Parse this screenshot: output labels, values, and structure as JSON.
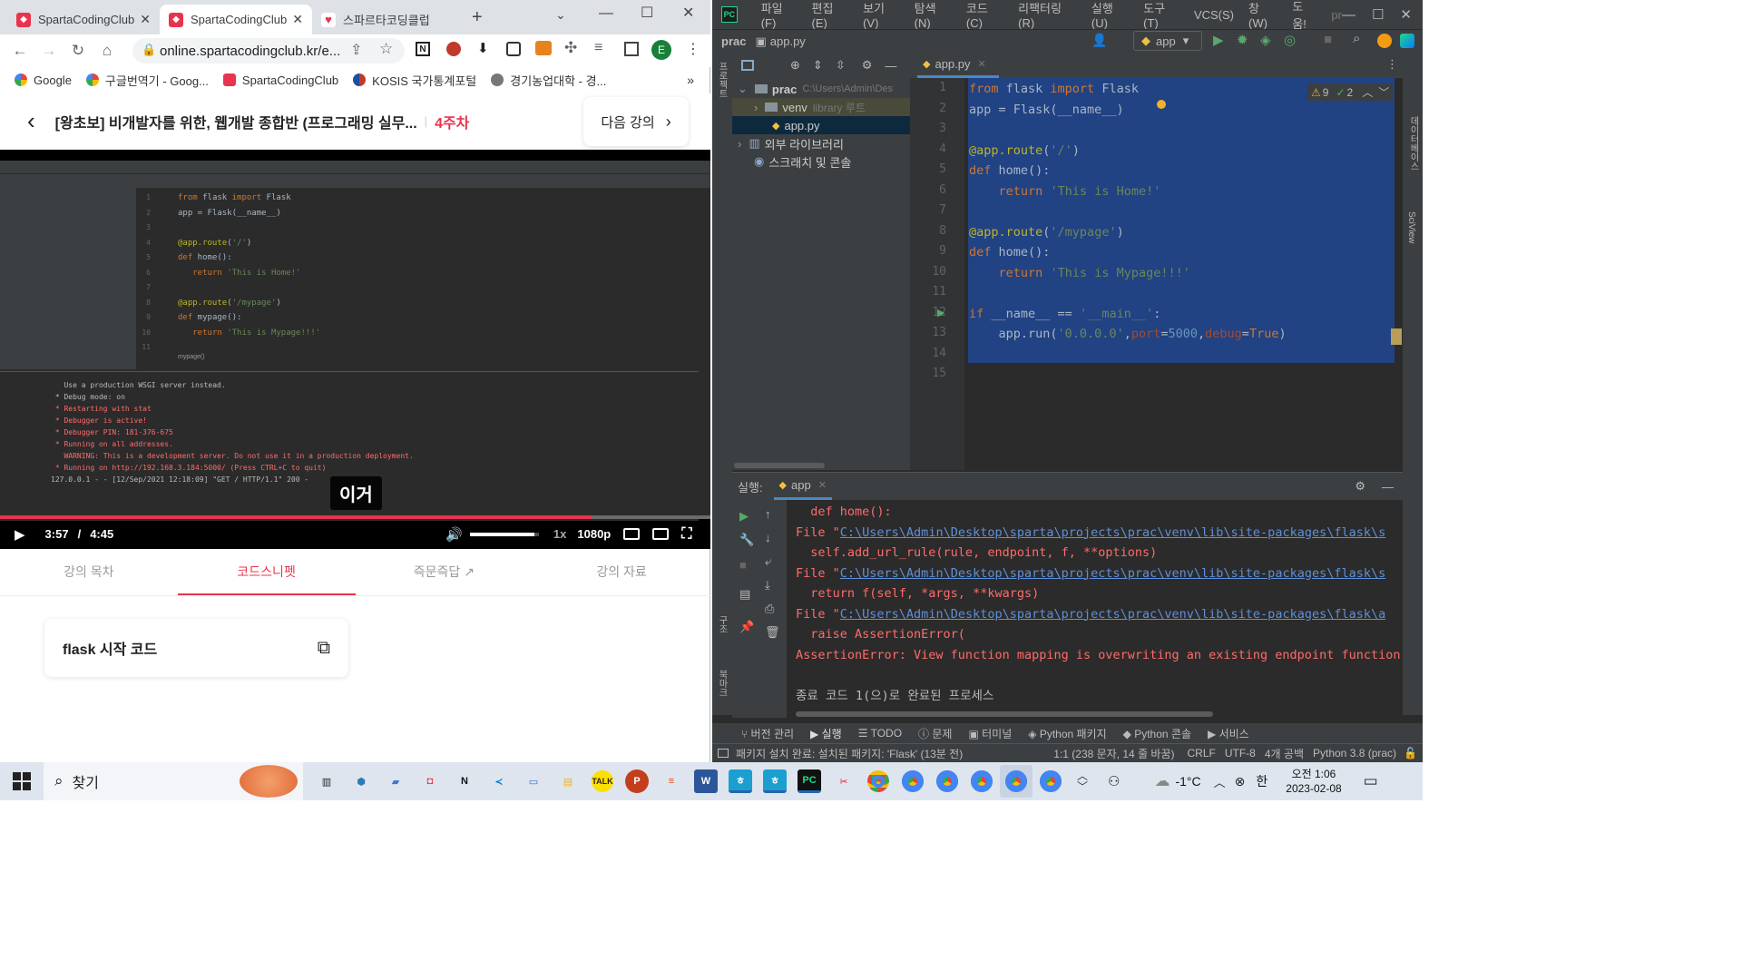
{
  "chrome": {
    "tabs": [
      {
        "title": "SpartaCodingClub",
        "active": false
      },
      {
        "title": "SpartaCodingClub",
        "active": true
      },
      {
        "title": "스파르타코딩클럽",
        "active": false
      }
    ],
    "new_tab": "+",
    "url": "online.spartacodingclub.kr/e...",
    "profile_initial": "E",
    "bookmarks": [
      "Google",
      "구글번역기 - Goog...",
      "SpartaCodingClub",
      "KOSIS 국가통계포털",
      "경기농업대학 - 경..."
    ],
    "bookmark_more": "»"
  },
  "course": {
    "title": "[왕초보] 비개발자를 위한, 웹개발 종합반 (프로그래밍 실무...",
    "week": "4주차",
    "next_label": "다음 강의"
  },
  "video": {
    "time_current": "3:57",
    "time_separator": "/",
    "time_total": "4:45",
    "speed": "1x",
    "quality": "1080p",
    "caption": "이거",
    "progress": 0.833,
    "volume": 0.94,
    "inner": {
      "code_lines": [
        {
          "n": "1",
          "text": "from flask import Flask"
        },
        {
          "n": "2",
          "text": "app = Flask(__name__)"
        },
        {
          "n": "3",
          "text": ""
        },
        {
          "n": "4",
          "text": "@app.route('/')"
        },
        {
          "n": "5",
          "text": "def home():"
        },
        {
          "n": "6",
          "text": "   return 'This is Home!'"
        },
        {
          "n": "7",
          "text": ""
        },
        {
          "n": "8",
          "text": "@app.route('/mypage')"
        },
        {
          "n": "9",
          "text": "def mypage():"
        },
        {
          "n": "10",
          "text": "   return 'This is Mypage!!!'"
        },
        {
          "n": "11",
          "text": ""
        }
      ],
      "breadcrumb": "mypage()",
      "console_lines": [
        {
          "text": "   Use a production WSGI server instead.",
          "color": "#bbbbbb"
        },
        {
          "text": " * Debug mode: on",
          "color": "#bbbbbb"
        },
        {
          "text": " * Restarting with stat",
          "color": "#ff6b68"
        },
        {
          "text": " * Debugger is active!",
          "color": "#ff6b68"
        },
        {
          "text": " * Debugger PIN: 181-376-675",
          "color": "#ff6b68"
        },
        {
          "text": " * Running on all addresses.",
          "color": "#ff6b68"
        },
        {
          "text": "   WARNING: This is a development server. Do not use it in a production deployment.",
          "color": "#ff6b68"
        },
        {
          "text": " * Running on http://192.168.3.184:5000/ (Press CTRL+C to quit)",
          "color": "#ff6b68"
        },
        {
          "text": "127.0.0.1 - - [12/Sep/2021 12:18:09] \"GET / HTTP/1.1\" 200 -",
          "color": "#bbbbbb"
        }
      ]
    }
  },
  "lecture_tabs": [
    {
      "label": "강의 목차",
      "active": false
    },
    {
      "label": "코드스니펫",
      "active": true
    },
    {
      "label": "즉문즉답",
      "active": false
    },
    {
      "label": "강의 자료",
      "active": false
    }
  ],
  "snippet": {
    "title": "flask 시작 코드"
  },
  "pycharm": {
    "menus": [
      "파일(F)",
      "편집(E)",
      "보기(V)",
      "탐색(N)",
      "코드(C)",
      "리팩터링(R)",
      "실행(U)",
      "도구(T)",
      "VCS(S)",
      "창(W)",
      "도움!",
      "pr"
    ],
    "project": "prac",
    "file": "app.py",
    "run_config": "app",
    "tree": {
      "root": "prac",
      "root_path": "C:\\Users\\Admin\\Des",
      "venv": "venv",
      "venv_note": "library 루트",
      "file": "app.py",
      "external": "외부 라이브러리",
      "scratches": "스크래치 및 콘솔"
    },
    "inspection": {
      "warnings": "9",
      "ok": "2"
    },
    "code_lines": [
      {
        "n": "1",
        "text": "from flask import Flask"
      },
      {
        "n": "2",
        "text": "app = Flask(__name__)"
      },
      {
        "n": "3",
        "text": ""
      },
      {
        "n": "4",
        "text": "@app.route('/')"
      },
      {
        "n": "5",
        "text": "def home():"
      },
      {
        "n": "6",
        "text": "    return 'This is Home!'"
      },
      {
        "n": "7",
        "text": ""
      },
      {
        "n": "8",
        "text": "@app.route('/mypage')"
      },
      {
        "n": "9",
        "text": "def home():"
      },
      {
        "n": "10",
        "text": "    return 'This is Mypage!!!'"
      },
      {
        "n": "11",
        "text": ""
      },
      {
        "n": "12",
        "text": "if __name__ == '__main__':"
      },
      {
        "n": "13",
        "text": "    app.run('0.0.0.0',port=5000,debug=True)"
      },
      {
        "n": "14",
        "text": ""
      },
      {
        "n": "15",
        "text": ""
      }
    ],
    "run": {
      "label": "실행:",
      "config": "app",
      "lines": [
        {
          "text": "  def home():",
          "kind": "err"
        },
        {
          "text": "File \"C:\\Users\\Admin\\Desktop\\sparta\\projects\\prac\\venv\\lib\\site-packages\\flask\\s",
          "kind": "link"
        },
        {
          "text": "  self.add_url_rule(rule, endpoint, f, **options)",
          "kind": "err"
        },
        {
          "text": "File \"C:\\Users\\Admin\\Desktop\\sparta\\projects\\prac\\venv\\lib\\site-packages\\flask\\s",
          "kind": "link"
        },
        {
          "text": "  return f(self, *args, **kwargs)",
          "kind": "err"
        },
        {
          "text": "File \"C:\\Users\\Admin\\Desktop\\sparta\\projects\\prac\\venv\\lib\\site-packages\\flask\\a",
          "kind": "link"
        },
        {
          "text": "  raise AssertionError(",
          "kind": "err"
        },
        {
          "text": "AssertionError: View function mapping is overwriting an existing endpoint function",
          "kind": "err"
        },
        {
          "text": "",
          "kind": "plain"
        },
        {
          "text": "종료 코드 1(으)로 완료된 프로세스",
          "kind": "plain"
        }
      ]
    },
    "bottom_tabs": [
      "버전 관리",
      "실행",
      "TODO",
      "문제",
      "터미널",
      "Python 패키지",
      "Python 콘솔",
      "서비스"
    ],
    "status": {
      "message": "패키지 설치 완료: 설치된 패키지: 'Flask' (13분 전)",
      "position": "1:1 (238 문자, 14 줄 바꿈)",
      "line_sep": "CRLF",
      "encoding": "UTF-8",
      "indent": "4개 공백",
      "interpreter": "Python 3.8 (prac)"
    },
    "side_labels": {
      "left_top": "프로젝트",
      "left_mid": "구조",
      "left_bot": "북마크",
      "right_top": "데이터베이스",
      "right_bot": "SciView"
    }
  },
  "taskbar": {
    "search": "찾기",
    "weather": "-1°C",
    "ime": "한",
    "time": "오전 1:06",
    "date": "2023-02-08"
  }
}
